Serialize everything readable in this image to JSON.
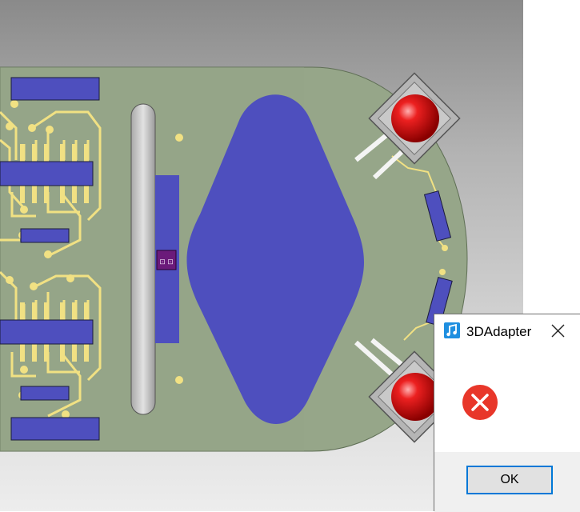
{
  "dialog": {
    "title": "3DAdapter",
    "ok_label": "OK",
    "icon": "error-icon",
    "app_icon": "music-note-app-icon"
  },
  "viewport": {
    "board_color": "#96a689",
    "pad_color": "#4e4fbe",
    "trace_color": "#f1e183",
    "led_color": "#d81414"
  },
  "component_label": "⊡ ⊡"
}
